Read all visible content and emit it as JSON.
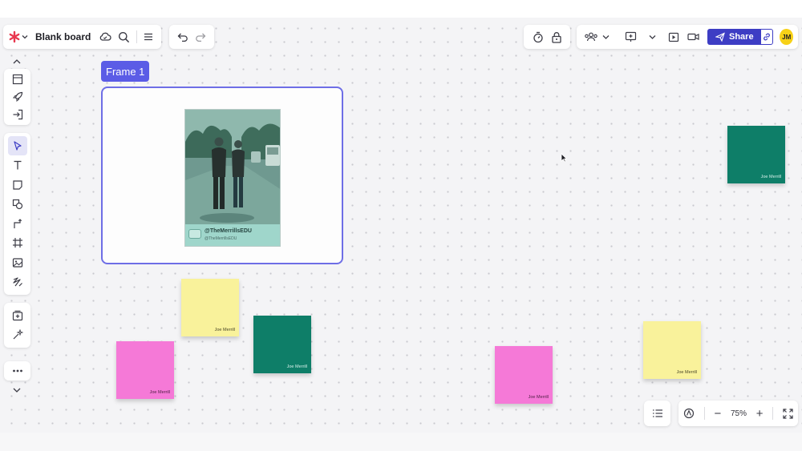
{
  "colors": {
    "accent": "#3d3dc4",
    "frame": "#6e6ee6",
    "frame_label_bg": "#5b5ce6",
    "avatar": "#f7d117",
    "sticky_yellow": "#f9f29b",
    "sticky_pink": "#f579d7",
    "sticky_green": "#0e7e68",
    "canvas_bg": "#f4f4f6",
    "logo_red": "#e8384f"
  },
  "toolbar": {
    "board_title": "Blank board",
    "share_label": "Share",
    "avatar_initials": "JM",
    "icons": [
      "app-logo-icon",
      "chevron-down-icon",
      "cloud-sync-icon",
      "search-icon",
      "hamburger-menu-icon",
      "undo-icon",
      "redo-icon",
      "timer-icon",
      "lock-icon",
      "collaborators-icon",
      "chevron-down-icon",
      "present-icon",
      "chevron-down-icon",
      "play-icon",
      "video-icon",
      "send-icon",
      "link-icon"
    ]
  },
  "left_tools": {
    "group1": [
      "template-icon",
      "rocket-icon",
      "import-icon"
    ],
    "group2": [
      "select-pointer-icon",
      "text-tool-icon",
      "sticky-note-icon",
      "shapes-icon",
      "connector-icon",
      "frame-tool-icon",
      "image-icon",
      "pen-icon"
    ],
    "group3": [
      "add-frame-icon",
      "magic-icon"
    ],
    "group4": [
      "more-icon"
    ]
  },
  "canvas": {
    "frame_label": "Frame 1",
    "photo": {
      "handle": "@TheMerrillsEDU",
      "sub": "@TheMerrillsEDU"
    },
    "stickies": [
      {
        "color": "green",
        "author": "Joe Merrill"
      },
      {
        "color": "yellow",
        "author": "Joe Merrill"
      },
      {
        "color": "green",
        "author": "Joe Merrill"
      },
      {
        "color": "pink",
        "author": "Joe Merrill"
      },
      {
        "color": "pink",
        "author": "Joe Merrill"
      },
      {
        "color": "yellow",
        "author": "Joe Merrill"
      }
    ]
  },
  "zoom": {
    "value": "75%",
    "minus_label": "−",
    "plus_label": "+"
  }
}
